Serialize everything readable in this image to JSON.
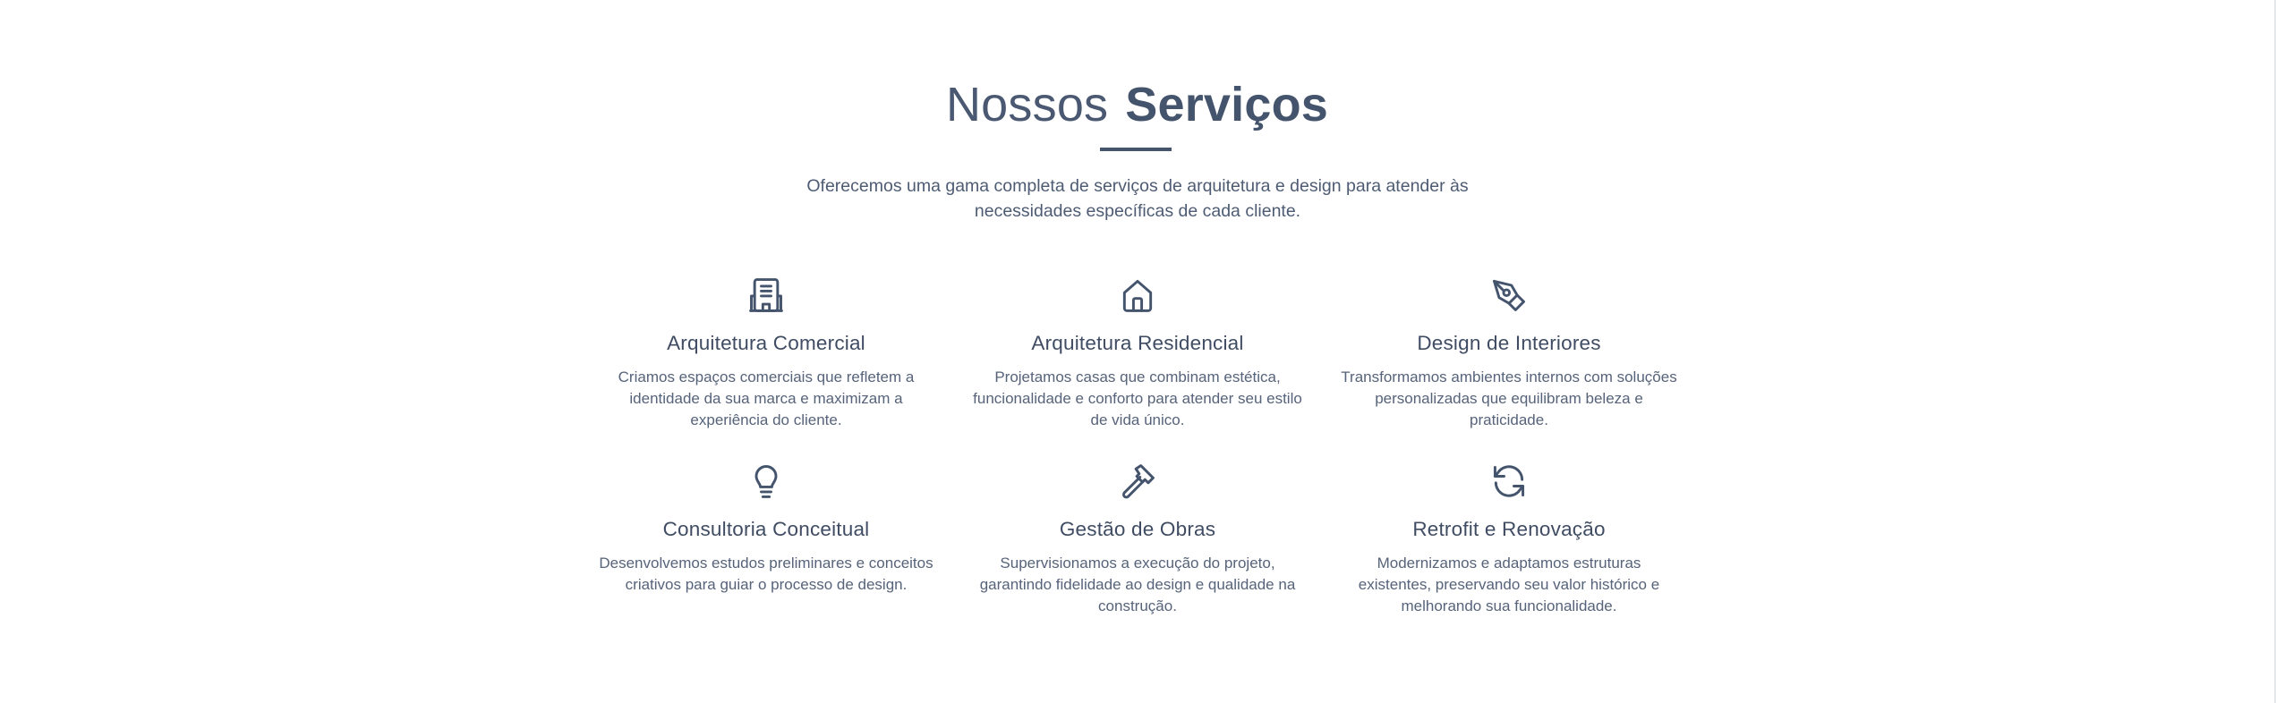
{
  "header": {
    "title_light": "Nossos",
    "title_bold": "Serviços",
    "subtitle": "Oferecemos uma gama completa de serviços de arquitetura e design para atender às necessidades específicas de cada cliente."
  },
  "services": [
    {
      "icon": "building-icon",
      "title": "Arquitetura Comercial",
      "description": "Criamos espaços comerciais que refletem a identidade da sua marca e maximizam a experiência do cliente."
    },
    {
      "icon": "home-icon",
      "title": "Arquitetura Residencial",
      "description": "Projetamos casas que combinam estética, funcionalidade e conforto para atender seu estilo de vida único."
    },
    {
      "icon": "pen-tool-icon",
      "title": "Design de Interiores",
      "description": "Transformamos ambientes internos com soluções personalizadas que equilibram beleza e praticidade."
    },
    {
      "icon": "lightbulb-icon",
      "title": "Consultoria Conceitual",
      "description": "Desenvolvemos estudos preliminares e conceitos criativos para guiar o processo de design."
    },
    {
      "icon": "hammer-icon",
      "title": "Gestão de Obras",
      "description": "Supervisionamos a execução do projeto, garantindo fidelidade ao design e qualidade na construção."
    },
    {
      "icon": "refresh-icon",
      "title": "Retrofit e Renovação",
      "description": "Modernizamos e adaptamos estruturas existentes, preservando seu valor histórico e melhorando sua funcionalidade."
    }
  ],
  "colors": {
    "text_primary": "#45546d",
    "text_secondary": "#56637a",
    "background": "#ffffff"
  }
}
